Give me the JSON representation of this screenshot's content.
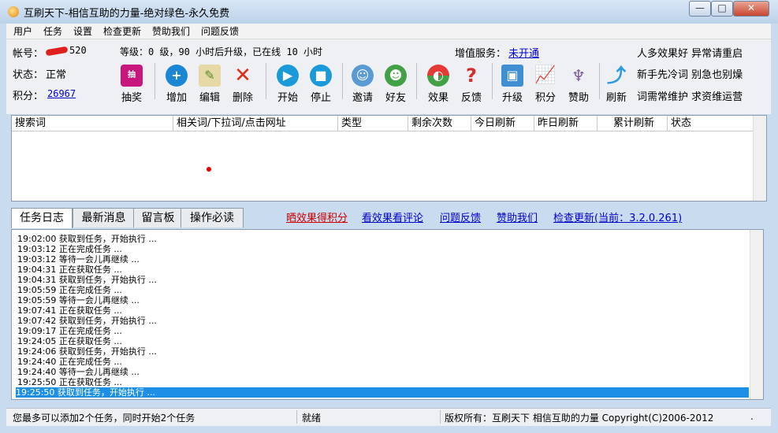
{
  "window": {
    "title": "互刷天下-相信互助的力量-绝对绿色-永久免费",
    "controls": {
      "minimize": "—",
      "maximize": "□",
      "close": "✕"
    }
  },
  "menu": [
    "用户",
    "任务",
    "设置",
    "检查更新",
    "赞助我们",
    "问题反馈"
  ],
  "account": {
    "label": "帐号：",
    "value_suffix": "520",
    "status_label": "状态：",
    "status_value": "正常",
    "points_label": "积分：",
    "points_value": "26967"
  },
  "level_text": "等级：0 级，90 小时后升级，已在线 10 小时",
  "value_added": {
    "label": "增值服务：",
    "link": "未开通"
  },
  "toolbar": [
    {
      "label": "抽奖",
      "icon": "lottery-bag-icon"
    },
    {
      "label": "增加",
      "icon": "add-icon"
    },
    {
      "label": "编辑",
      "icon": "edit-icon"
    },
    {
      "label": "删除",
      "icon": "delete-icon"
    },
    {
      "label": "开始",
      "icon": "play-icon"
    },
    {
      "label": "停止",
      "icon": "stop-icon"
    },
    {
      "label": "邀请",
      "icon": "invite-icon"
    },
    {
      "label": "好友",
      "icon": "friends-icon"
    },
    {
      "label": "效果",
      "icon": "effect-icon"
    },
    {
      "label": "反馈",
      "icon": "feedback-icon"
    },
    {
      "label": "升级",
      "icon": "upgrade-icon"
    },
    {
      "label": "积分",
      "icon": "points-chart-icon"
    },
    {
      "label": "赞助",
      "icon": "sponsor-icon"
    },
    {
      "label": "刷新",
      "icon": "refresh-icon"
    }
  ],
  "notes": [
    "人多效果好 异常请重启",
    "新手先冷词 别急也别燥",
    "词需常维护 求资维运营"
  ],
  "table": {
    "columns": [
      "搜索词",
      "相关词/下拉词/点击网址",
      "类型",
      "剩余次数",
      "今日刷新",
      "昨日刷新",
      "累计刷新",
      "状态"
    ]
  },
  "tabs": [
    "任务日志",
    "最新消息",
    "留言板",
    "操作必读"
  ],
  "links": [
    "晒效果得积分",
    "看效果看评论",
    "问题反馈",
    "赞助我们",
    "检查更新(当前：3.2.0.261)"
  ],
  "log": [
    "19:02:00 获取到任务，开始执行 ...",
    "19:03:12 正在完成任务 ...",
    "19:03:12 等待一会儿再继续 ...",
    "19:04:31 正在获取任务 ...",
    "19:04:31 获取到任务，开始执行 ...",
    "19:05:59 正在完成任务 ...",
    "19:05:59 等待一会儿再继续 ...",
    "19:07:41 正在获取任务 ...",
    "19:07:42 获取到任务，开始执行 ...",
    "19:09:17 正在完成任务 ...",
    "19:24:05 正在获取任务 ...",
    "19:24:06 获取到任务，开始执行 ...",
    "19:24:40 正在完成任务 ...",
    "19:24:40 等待一会儿再继续 ...",
    "19:25:50 正在获取任务 ...",
    "19:25:50 获取到任务，开始执行 ..."
  ],
  "status": {
    "left": "您最多可以添加2个任务，同时开始2个任务",
    "middle": "就绪",
    "right": "版权所有：互刷天下 相信互助的力量 Copyright(C)2006-2012",
    "end": "."
  },
  "colors": {
    "link": "#0000cc",
    "highlight_link": "#cc0000",
    "selection": "#1d8fe6"
  }
}
